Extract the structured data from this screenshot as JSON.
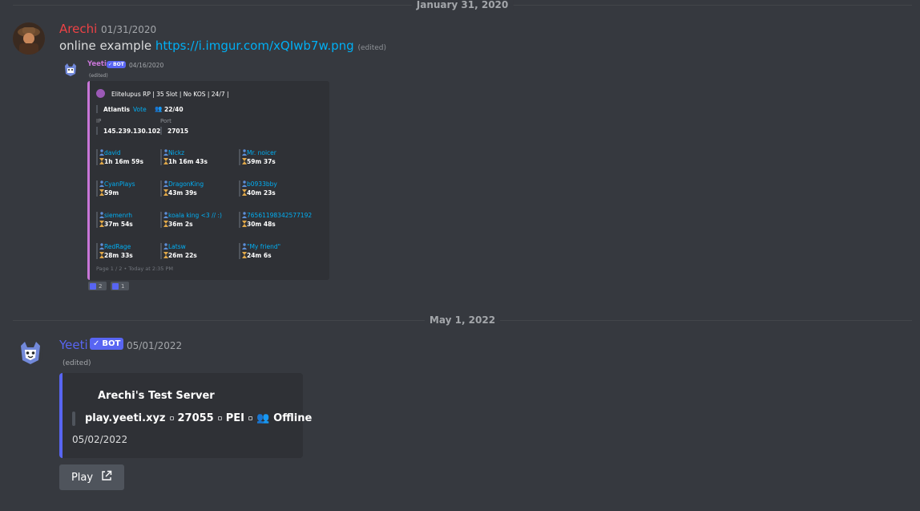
{
  "dividers": [
    "January 31, 2020",
    "May 1, 2022"
  ],
  "message1": {
    "author": "Arechi",
    "timestamp": "01/31/2020",
    "text": "online example ",
    "link": "https://i.imgur.com/xQIwb7w.png",
    "edited": "(edited)"
  },
  "reply": {
    "author": "Yeeti",
    "bot_tag": "BOT",
    "timestamp": "04/16/2020",
    "edited": "(edited)",
    "embed": {
      "title": "Elitelupus RP | 35 Slot | No KOS | 24/7 |",
      "map": "Atlantis",
      "vote": "Vote",
      "players": "22/40",
      "ip_label": "IP",
      "ip": "145.239.130.102",
      "port_label": "Port",
      "port": "27015",
      "player_rows": [
        [
          {
            "name": "david",
            "time": "1h 16m 59s"
          },
          {
            "name": "Nickz",
            "time": "1h 16m 43s"
          },
          {
            "name": "Mr. noicer",
            "time": "59m 37s"
          }
        ],
        [
          {
            "name": "CyanPlays",
            "time": "59m"
          },
          {
            "name": "DragonKing",
            "time": "43m 39s"
          },
          {
            "name": "b0933bby",
            "time": "40m 23s"
          }
        ],
        [
          {
            "name": "siemenrh",
            "time": "37m 54s"
          },
          {
            "name": "koala king <3 // :)",
            "time": "36m 2s"
          },
          {
            "name": "76561198342577192",
            "time": "30m 48s"
          }
        ],
        [
          {
            "name": "RedRage",
            "time": "28m 33s"
          },
          {
            "name": "Latsw",
            "time": "26m 22s"
          },
          {
            "name": "\"My friend\"",
            "time": "24m 6s"
          }
        ]
      ],
      "footer": "Page 1 / 2 • Today at 2:35 PM"
    },
    "buttons": [
      {
        "label": "2"
      },
      {
        "label": "1"
      }
    ]
  },
  "message2": {
    "author": "Yeeti",
    "bot_tag": "BOT",
    "timestamp": "05/01/2022",
    "edited": "(edited)",
    "embed": {
      "title": "Arechi's Test Server",
      "address": "play.yeeti.xyz",
      "port": "27055",
      "map": "PEI",
      "status": "Offline",
      "date": "05/02/2022"
    },
    "button": "Play"
  },
  "colors": {
    "arechi": "#ed4245",
    "yeeti": "#5865f2",
    "mini_yeeti": "#c876d8",
    "link": "#00aff4"
  },
  "icons": [
    "avatar-arechi",
    "avatar-yeeti",
    "player-icon",
    "hourglass-icon",
    "external-link-icon",
    "rewind-icon",
    "fast-forward-icon"
  ]
}
